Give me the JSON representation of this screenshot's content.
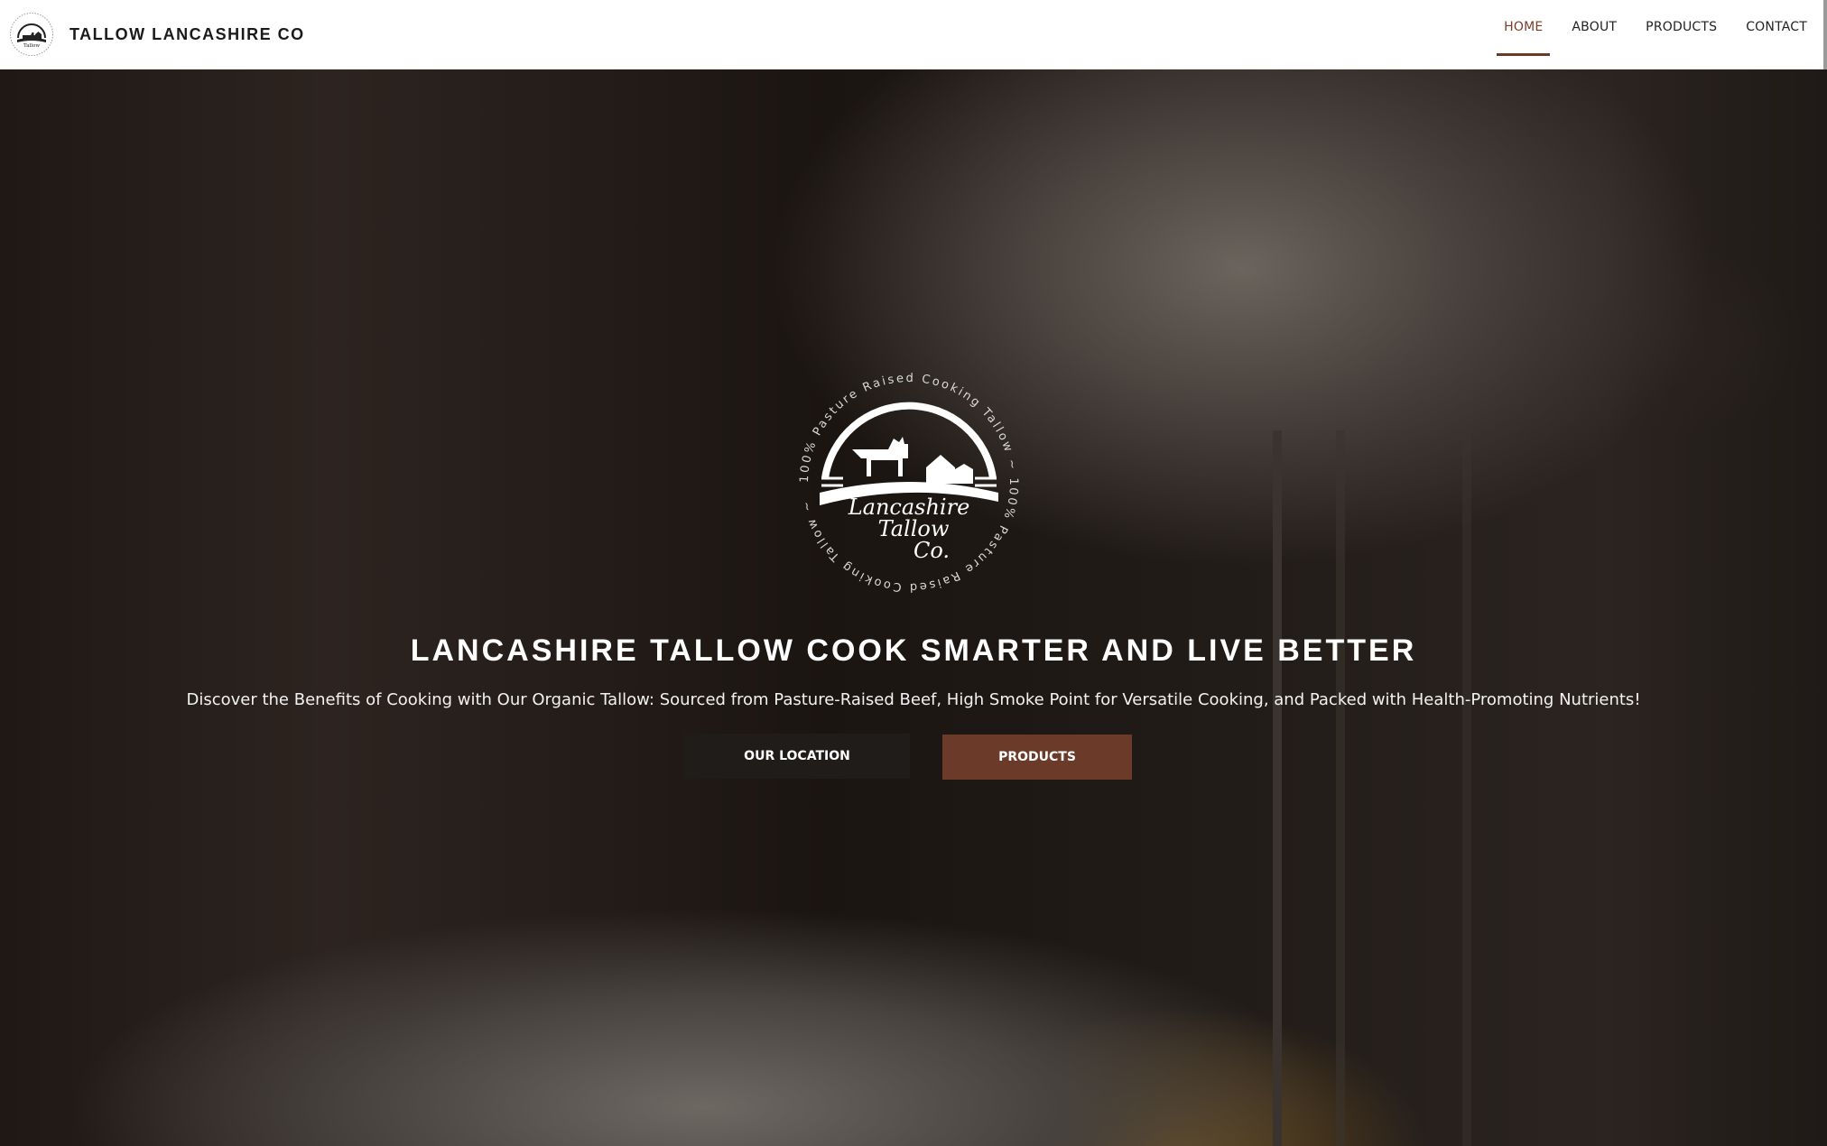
{
  "brand": {
    "name": "TALLOW LANCASHIRE CO",
    "logo_icon": "lancashire-tallow-logo-icon"
  },
  "nav": {
    "items": [
      {
        "label": "HOME",
        "active": true
      },
      {
        "label": "ABOUT",
        "active": false
      },
      {
        "label": "PRODUCTS",
        "active": false
      },
      {
        "label": "CONTACT",
        "active": false
      }
    ]
  },
  "hero": {
    "logo": {
      "ring_text": "100% Pasture Raised Cooking Tallow ~ 100% Pasture Raised Cooking Tallow ~",
      "word1": "Lancashire",
      "word2": "Tallow",
      "word3": "Co."
    },
    "title": "LANCASHIRE TALLOW COOK SMARTER AND LIVE BETTER",
    "subtitle": "Discover the Benefits of Cooking with Our Organic Tallow: Sourced from Pasture-Raised Beef, High Smoke Point for Versatile Cooking, and Packed with Health-Promoting Nutrients!",
    "buttons": {
      "location": "OUR LOCATION",
      "products": "PRODUCTS"
    }
  },
  "colors": {
    "accent": "#6b3a29",
    "nav_active": "#7a3d28",
    "header_bg": "#ffffff",
    "dark_button": "#1f1c1a"
  }
}
